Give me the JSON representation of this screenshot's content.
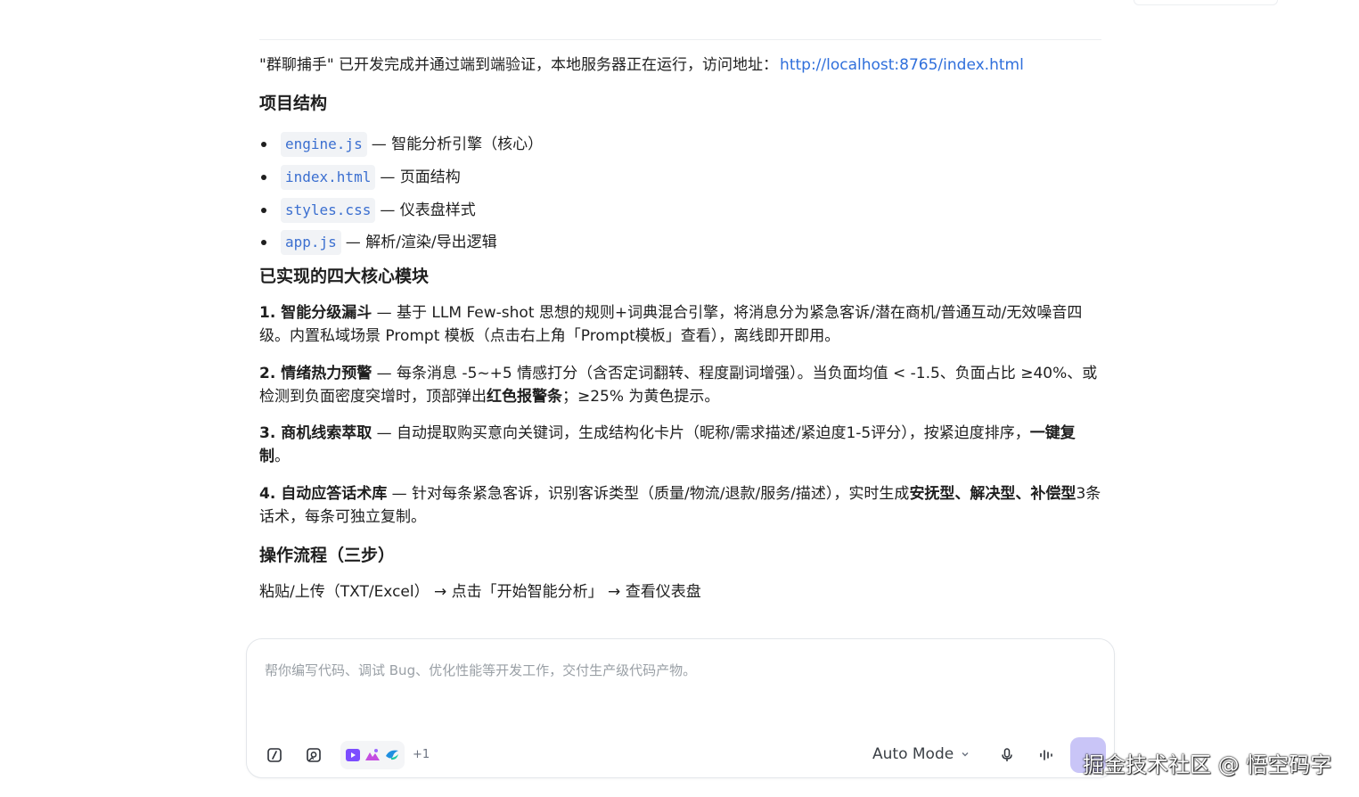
{
  "intro": {
    "text": "\"群聊捕手\" 已开发完成并通过端到端验证，本地服务器正在运行，访问地址：",
    "link": "http://localhost:8765/index.html"
  },
  "project": {
    "heading": "项目结构",
    "files": [
      {
        "name": "engine.js",
        "desc": "— 智能分析引擎（核心）"
      },
      {
        "name": "index.html",
        "desc": "— 页面结构"
      },
      {
        "name": "styles.css",
        "desc": "— 仪表盘样式"
      },
      {
        "name": "app.js",
        "desc": "— 解析/渲染/导出逻辑"
      }
    ]
  },
  "modules": {
    "heading": "已实现的四大核心模块",
    "m1": {
      "title": "1. 智能分级漏斗",
      "text": " — 基于 LLM Few-shot 思想的规则+词典混合引擎，将消息分为紧急客诉/潜在商机/普通互动/无效噪音四级。内置私域场景 Prompt 模板（点击右上角「Prompt模板」查看），离线即开即用。"
    },
    "m2": {
      "title": "2. 情绪热力预警",
      "text": " — 每条消息 -5~+5 情感打分（含否定词翻转、程度副词增强）。当负面均值 < -1.5、负面占比 ≥40%、或检测到负面密度突增时，顶部弹出",
      "bold": "红色报警条",
      "tail": "；≥25% 为黄色提示。"
    },
    "m3": {
      "title": "3. 商机线索萃取",
      "text": " — 自动提取购买意向关键词，生成结构化卡片（昵称/需求描述/紧迫度1-5评分），按紧迫度排序，",
      "bold": "一键复制",
      "tail": "。"
    },
    "m4": {
      "title": "4. 自动应答话术库",
      "text": " — 针对每条紧急客诉，识别客诉类型（质量/物流/退款/服务/描述），实时生成",
      "bold": "安抚型、解决型、补偿型",
      "tail": "3条话术，每条可独立复制。"
    }
  },
  "flow": {
    "heading": "操作流程（三步）",
    "text": "粘贴/上传（TXT/Excel） → 点击「开始智能分析」 → 查看仪表盘"
  },
  "composer": {
    "placeholder": "帮你编写代码、调试 Bug、优化性能等开发工作，交付生产级代码产物。",
    "extra_count": "+1",
    "mode_label": "Auto Mode",
    "icons": [
      "slash-command-icon",
      "image-upload-icon",
      "video-app-icon",
      "image-app-icon",
      "bird-app-icon",
      "microphone-icon",
      "voice-wave-icon",
      "send-icon"
    ]
  },
  "watermark": "掘金技术社区 @ 悟空码字",
  "colors": {
    "link": "#2f6fdb",
    "code": "#3b6fd0",
    "send": "#c9c5f7"
  }
}
